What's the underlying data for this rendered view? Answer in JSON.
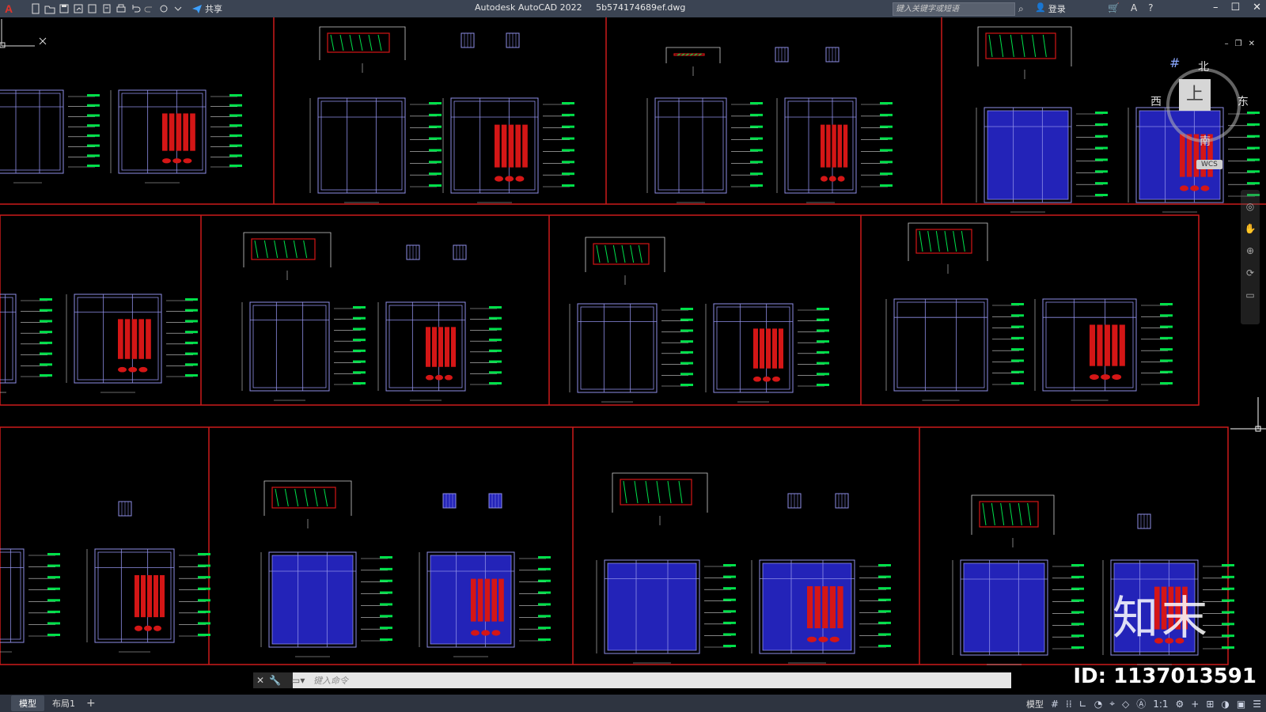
{
  "app": {
    "title": "Autodesk AutoCAD 2022",
    "filename": "5b574174689ef.dwg",
    "logo_letter": "A",
    "share_label": "共享",
    "search_placeholder": "键入关键字或短语",
    "login_label": "登录"
  },
  "viewcube": {
    "north": "北",
    "south": "南",
    "west": "西",
    "east": "东",
    "top_face": "上",
    "wcs_label": "WCS"
  },
  "command": {
    "placeholder": "键入命令"
  },
  "status": {
    "tabs": [
      {
        "label": "模型",
        "active": true
      },
      {
        "label": "布局1",
        "active": false
      }
    ],
    "model_label": "模型",
    "scale_label": "1:1"
  },
  "watermark": {
    "brand_cn": "知末",
    "id_label": "ID: 1137013591"
  },
  "colors": {
    "frame": "#cc1a1a",
    "line": "#8e8ee6",
    "fill_red": "#d41616",
    "green": "#00e04a",
    "blue": "#2323b8",
    "dim": "#cfcfcf",
    "titlebar": "#3b4453",
    "statusbar": "#2e3440"
  }
}
